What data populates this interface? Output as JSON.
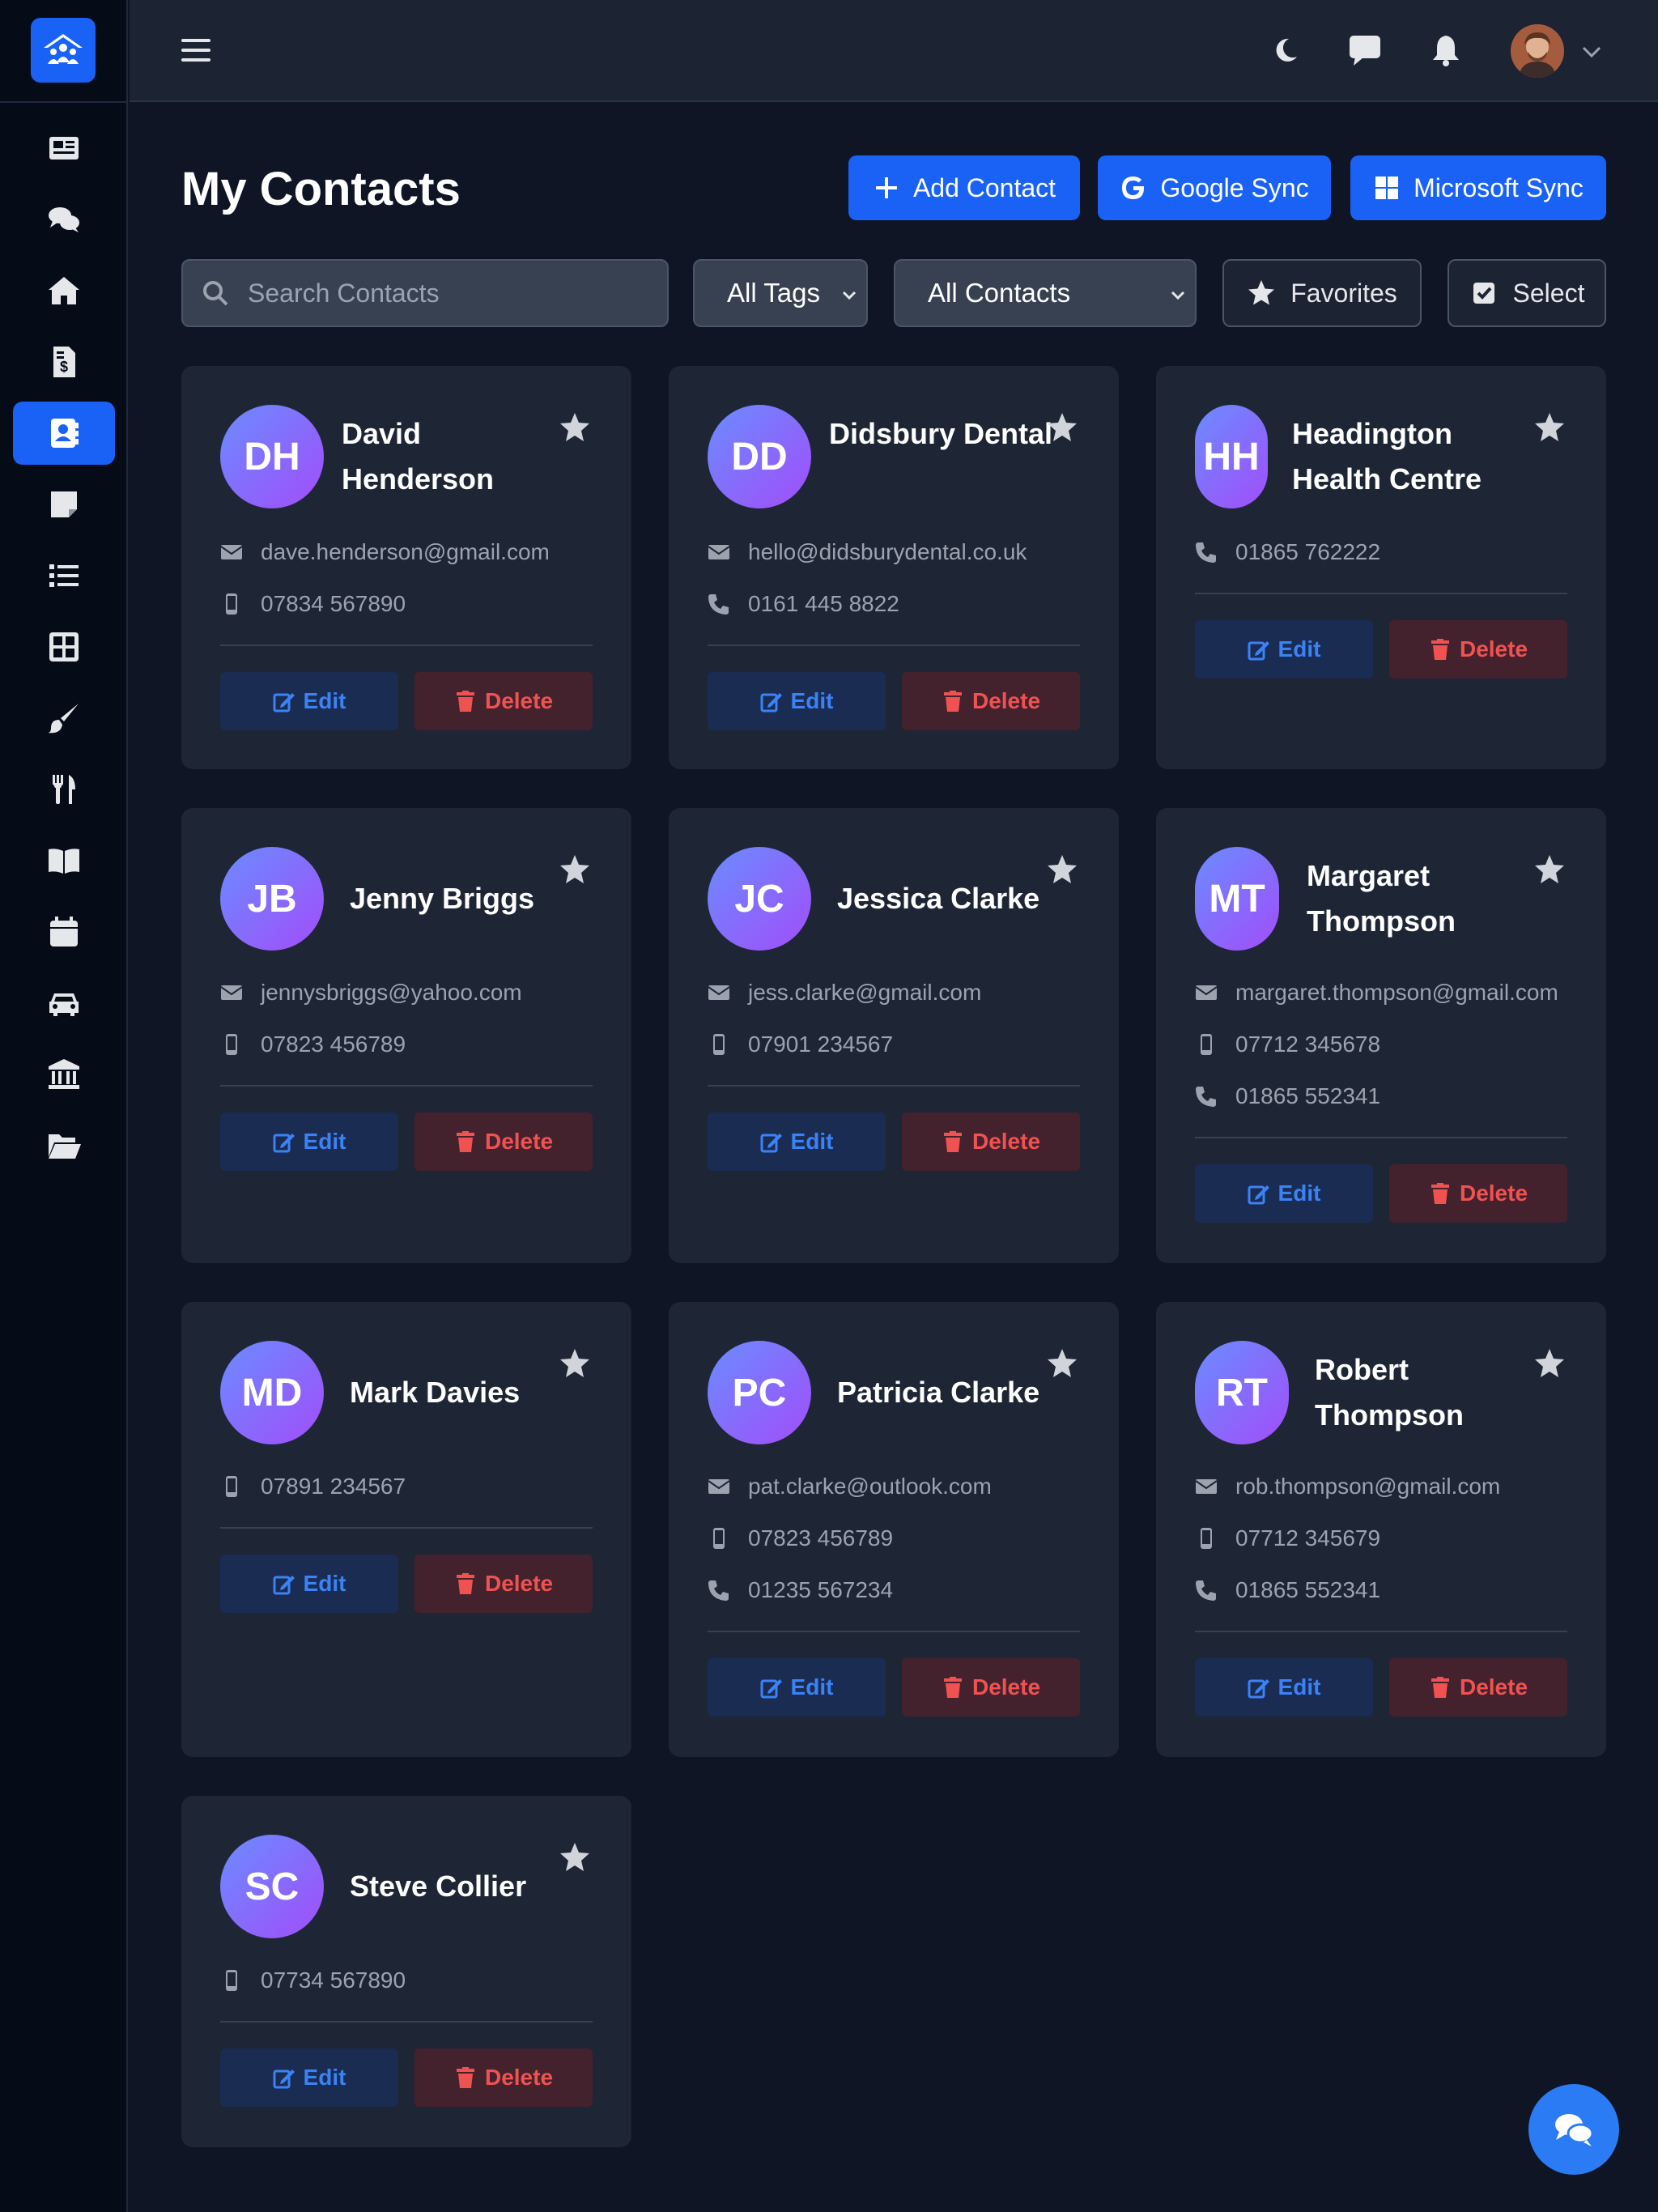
{
  "page": {
    "title": "My Contacts"
  },
  "actions": {
    "add_contact": "Add Contact",
    "google_sync": "Google Sync",
    "microsoft_sync": "Microsoft Sync"
  },
  "filters": {
    "search_placeholder": "Search Contacts",
    "tags_select": "All Tags",
    "contacts_select": "All Contacts",
    "favorites": "Favorites",
    "select": "Select"
  },
  "nav_icons": [
    "news-icon",
    "chat-icon",
    "home-icon",
    "invoice-icon",
    "contacts-icon",
    "notes-icon",
    "list-icon",
    "grid-icon",
    "brush-icon",
    "utensils-icon",
    "book-icon",
    "calendar-icon",
    "car-icon",
    "bank-icon",
    "folder-icon"
  ],
  "nav_active": "contacts-icon",
  "buttons": {
    "edit": "Edit",
    "delete": "Delete"
  },
  "contacts": [
    {
      "initials": "DH",
      "name": "David Henderson",
      "email": "dave.henderson@gmail.com",
      "mobile": "07834 567890"
    },
    {
      "initials": "DD",
      "name": "Didsbury Dental",
      "email": "hello@didsburydental.co.uk",
      "phone": "0161 445 8822"
    },
    {
      "initials": "HH",
      "name": "Headington Health Centre",
      "phone": "01865 762222"
    },
    {
      "initials": "JB",
      "name": "Jenny Briggs",
      "email": "jennysbriggs@yahoo.com",
      "mobile": "07823 456789"
    },
    {
      "initials": "JC",
      "name": "Jessica Clarke",
      "email": "jess.clarke@gmail.com",
      "mobile": "07901 234567"
    },
    {
      "initials": "MT",
      "name": "Margaret Thompson",
      "email": "margaret.thompson@gmail.com",
      "mobile": "07712 345678",
      "phone": "01865 552341"
    },
    {
      "initials": "MD",
      "name": "Mark Davies",
      "mobile": "07891 234567"
    },
    {
      "initials": "PC",
      "name": "Patricia Clarke",
      "email": "pat.clarke@outlook.com",
      "mobile": "07823 456789",
      "phone": "01235 567234"
    },
    {
      "initials": "RT",
      "name": "Robert Thompson",
      "email": "rob.thompson@gmail.com",
      "mobile": "07712 345679",
      "phone": "01865 552341"
    },
    {
      "initials": "SC",
      "name": "Steve Collier",
      "mobile": "07734 567890"
    }
  ],
  "colors": {
    "accent": "#1a62f5",
    "edit": "#3b82f6",
    "delete": "#f05252"
  }
}
